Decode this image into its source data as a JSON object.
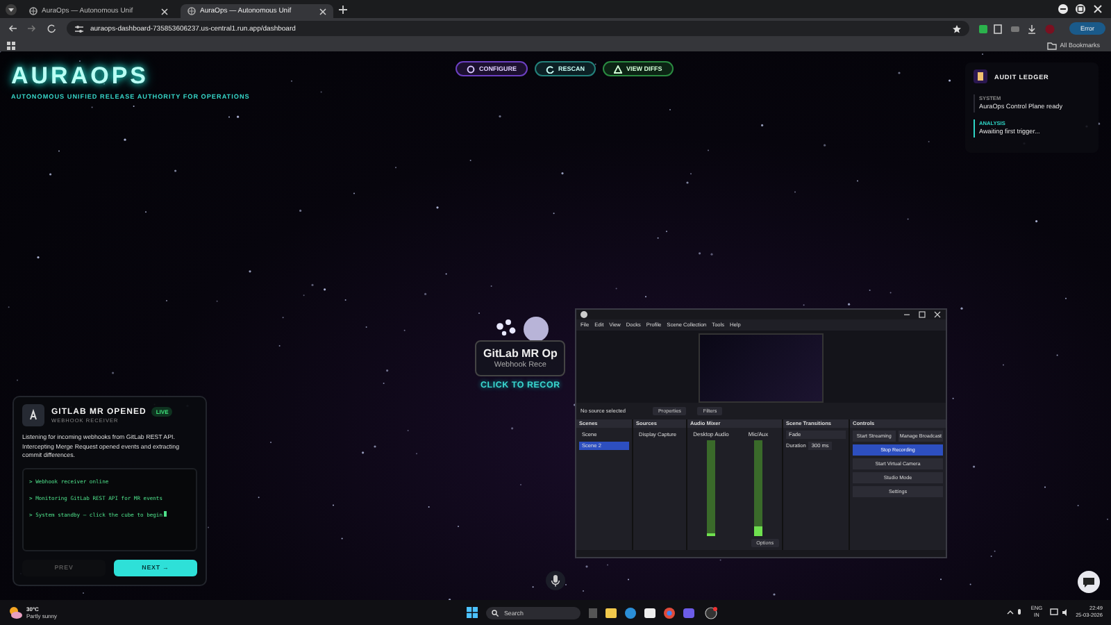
{
  "browser": {
    "tabs": [
      {
        "title": "AuraOps — Autonomous Unif",
        "selected": false
      },
      {
        "title": "AuraOps — Autonomous Unif",
        "selected": true
      }
    ],
    "url": "auraops-dashboard-735853606237.us-central1.run.app/dashboard",
    "profile": "Error",
    "bookmarks": "All Bookmarks"
  },
  "header": {
    "logo": "AURAOPS",
    "tagline": "AUTONOMOUS UNIFIED RELEASE AUTHORITY FOR OPERATIONS",
    "actions": [
      {
        "label": "CONFIGURE",
        "kind": "purple"
      },
      {
        "label": "RESCAN",
        "kind": "teal"
      },
      {
        "label": "VIEW DIFFS",
        "kind": "green"
      }
    ]
  },
  "audit": {
    "title": "AUDIT LEDGER",
    "entries": [
      {
        "type": "SYSTEM",
        "message": "AuraOps Control Plane ready",
        "active": false
      },
      {
        "type": "ANALYSIS",
        "message": "Awaiting first trigger...",
        "active": true
      }
    ]
  },
  "node": {
    "title": "GitLab MR Op",
    "subtitle": "Webhook Rece",
    "action": "CLICK TO RECOR"
  },
  "card": {
    "title": "GITLAB MR OPENED",
    "badge": "LIVE",
    "subtitle": "WEBHOOK RECEIVER",
    "description": "Listening for incoming webhooks from GitLab REST API. Intercepting Merge Request opened events and extracting commit differences.",
    "log": [
      "> Webhook receiver online",
      "> Monitoring GitLab REST API for MR events",
      "> System standby — click the cube to begin"
    ],
    "prev": {
      "label": "PREV",
      "disabled": true
    },
    "next": {
      "label": "NEXT →",
      "disabled": false
    }
  },
  "obs": {
    "menu": [
      "File",
      "Edit",
      "View",
      "Docks",
      "Profile",
      "Scene Collection",
      "Tools",
      "Help"
    ],
    "source_bar": {
      "status": "No source selected",
      "buttons": [
        "Properties",
        "Filters"
      ]
    },
    "docks": {
      "scenes": "Scenes",
      "sources": "Sources",
      "mixer": "Audio Mixer",
      "transitions": "Scene Transitions",
      "controls": "Controls"
    },
    "scenes": [
      {
        "name": "Scene",
        "selected": false
      },
      {
        "name": "Scene 2",
        "selected": true
      }
    ],
    "sources": [
      "Display Capture"
    ],
    "channels": [
      {
        "name": "Desktop Audio",
        "level": 0.03
      },
      {
        "name": "Mic/Aux",
        "level": 0.1
      }
    ],
    "mixer_options": "Options",
    "transition": "Fade",
    "duration_label": "Duration",
    "duration": "300 ms",
    "controls": [
      {
        "label": "Start Streaming",
        "active": false
      },
      {
        "label": "Manage Broadcast",
        "active": false
      },
      {
        "label": "Stop Recording",
        "active": true
      },
      {
        "label": "Start Virtual Camera",
        "active": false
      },
      {
        "label": "Studio Mode",
        "active": false
      },
      {
        "label": "Settings",
        "active": false
      }
    ]
  },
  "taskbar": {
    "temperature": "30°C",
    "weather": "Partly sunny",
    "search": "Search",
    "lang": "ENG",
    "region": "IN",
    "time": "22:49",
    "date": "25-03-2026"
  }
}
